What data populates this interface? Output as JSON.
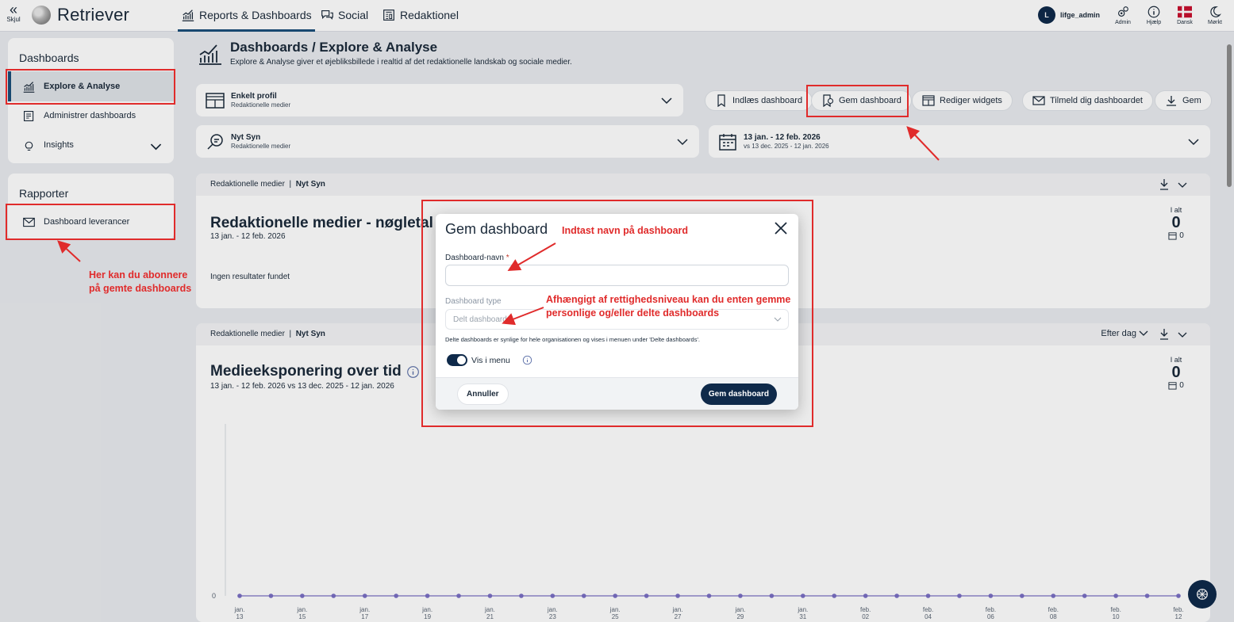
{
  "topbar": {
    "hide_label": "Skjul",
    "logo_text": "Retriever",
    "tabs": [
      {
        "label": "Reports & Dashboards",
        "icon": "chart-icon",
        "active": true
      },
      {
        "label": "Social",
        "icon": "chat-icon",
        "active": false
      },
      {
        "label": "Redaktionel",
        "icon": "newspaper-icon",
        "active": false
      }
    ],
    "user": {
      "initial": "L",
      "name": "lifge_admin"
    },
    "icons": [
      {
        "label": "Admin",
        "icon": "gears-icon"
      },
      {
        "label": "Hjælp",
        "icon": "info-icon"
      },
      {
        "label": "Dansk",
        "icon": "danish-flag-icon"
      },
      {
        "label": "Mørkt",
        "icon": "moon-icon"
      }
    ]
  },
  "sidebar": {
    "dashboards_heading": "Dashboards",
    "items": [
      {
        "label": "Explore & Analyse",
        "icon": "chart-icon",
        "active": true
      },
      {
        "label": "Administrer dashboards",
        "icon": "list-icon",
        "active": false
      },
      {
        "label": "Insights",
        "icon": "bulb-icon",
        "active": false
      }
    ],
    "reports_heading": "Rapporter",
    "report_items": [
      {
        "label": "Dashboard leverancer",
        "icon": "mail-icon"
      }
    ]
  },
  "page": {
    "title": "Dashboards / Explore & Analyse",
    "subtitle": "Explore & Analyse giver et øjebliksbillede i realtid af det redaktionelle landskab og sociale medier."
  },
  "selectors": {
    "profile": {
      "title": "Enkelt profil",
      "sub": "Redaktionelle medier"
    },
    "view": {
      "title": "Nyt Syn",
      "sub": "Redaktionelle medier"
    },
    "date": {
      "title": "13 jan. - 12 feb. 2026",
      "sub": "vs 13 dec. 2025 - 12 jan. 2026"
    }
  },
  "toolbar": {
    "load": "Indlæs dashboard",
    "save_dashboard": "Gem dashboard",
    "edit_widgets": "Rediger widgets",
    "subscribe": "Tilmeld dig dashboardet",
    "save": "Gem"
  },
  "panel1": {
    "crumb_a": "Redaktionelle medier",
    "crumb_sep": "|",
    "crumb_b": "Nyt Syn",
    "title": "Redaktionelle medier - nøgletal",
    "range": "13 jan. - 12 feb. 2026",
    "no_results": "Ingen resultater fundet",
    "kpi_label": "I alt",
    "kpi_value": "0",
    "kpi_compare": "0"
  },
  "panel2": {
    "crumb_a": "Redaktionelle medier",
    "crumb_sep": "|",
    "crumb_b": "Nyt Syn",
    "title": "Medieeksponering over tid",
    "range": "13 jan. - 12 feb. 2026 vs 13 dec. 2025 - 12 jan. 2026",
    "granularity": "Efter dag",
    "kpi_label": "I alt",
    "kpi_value": "0",
    "kpi_compare": "0"
  },
  "chart_data": {
    "type": "line",
    "title": "Medieeksponering over tid",
    "y_tick": "0",
    "x_labels": [
      {
        "m": "jan.",
        "d": "13"
      },
      {
        "m": "jan.",
        "d": "15"
      },
      {
        "m": "jan.",
        "d": "17"
      },
      {
        "m": "jan.",
        "d": "19"
      },
      {
        "m": "jan.",
        "d": "21"
      },
      {
        "m": "jan.",
        "d": "23"
      },
      {
        "m": "jan.",
        "d": "25"
      },
      {
        "m": "jan.",
        "d": "27"
      },
      {
        "m": "jan.",
        "d": "29"
      },
      {
        "m": "jan.",
        "d": "31"
      },
      {
        "m": "feb.",
        "d": "02"
      },
      {
        "m": "feb.",
        "d": "04"
      },
      {
        "m": "feb.",
        "d": "06"
      },
      {
        "m": "feb.",
        "d": "08"
      },
      {
        "m": "feb.",
        "d": "10"
      },
      {
        "m": "feb.",
        "d": "12"
      }
    ],
    "values": [
      0,
      0,
      0,
      0,
      0,
      0,
      0,
      0,
      0,
      0,
      0,
      0,
      0,
      0,
      0,
      0,
      0,
      0,
      0,
      0,
      0,
      0,
      0,
      0,
      0,
      0,
      0,
      0,
      0,
      0,
      0
    ],
    "series_color": "#7a6fc4"
  },
  "modal": {
    "title": "Gem dashboard",
    "name_label": "Dashboard-navn",
    "required_mark": "*",
    "name_value": "",
    "type_label": "Dashboard type",
    "type_value": "Delt dashboard",
    "hint": "Delte dashboards er synlige for hele organisationen og vises i menuen under 'Delte dashboards'.",
    "toggle_label": "Vis i menu",
    "toggle_on": true,
    "cancel": "Annuller",
    "submit": "Gem dashboard"
  },
  "annotations": {
    "name_note": "Indtast navn på dashboard",
    "type_note_1": "Afhængigt af rettighedsniveau kan du enten gemme",
    "type_note_2": "personlige og/eller delte dashboards",
    "sub_note_1": "Her kan du abonnere",
    "sub_note_2": "på gemte dashboards"
  },
  "colors": {
    "accent": "#0f2a4a",
    "annotation": "#e02b2b",
    "active_tab": "#1b4f7a"
  }
}
